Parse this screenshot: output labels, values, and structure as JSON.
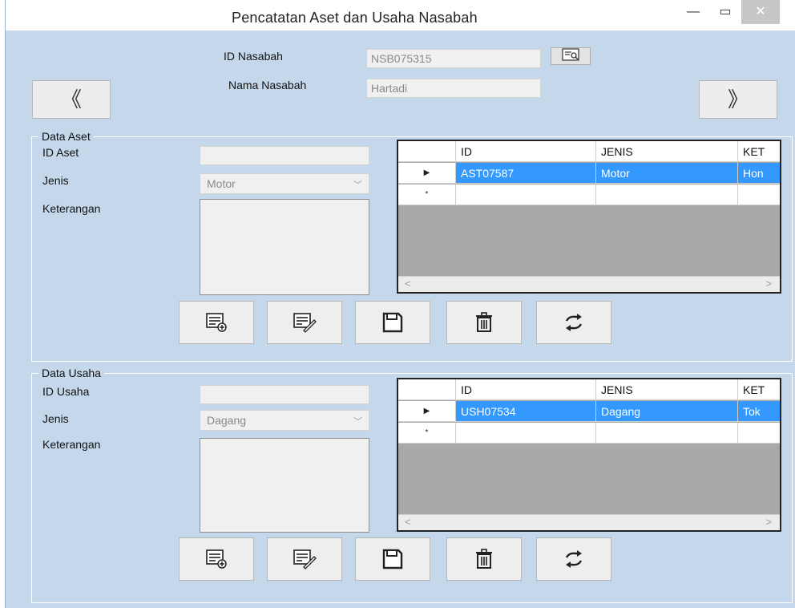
{
  "window": {
    "title": "Pencatatan Aset dan Usaha Nasabah",
    "min_glyph": "—",
    "max_glyph": "▭",
    "close_glyph": "✕"
  },
  "nasabah": {
    "id_label": "ID Nasabah",
    "id_value": "NSB075315",
    "nama_label": "Nama Nasabah",
    "nama_value": "Hartadi",
    "prev_glyph": "《",
    "next_glyph": "》"
  },
  "aset": {
    "group_label": "Data Aset",
    "id_label": "ID Aset",
    "id_value": "",
    "jenis_label": "Jenis",
    "jenis_value": "Motor",
    "keterangan_label": "Keterangan",
    "grid": {
      "columns": [
        "ID",
        "JENIS",
        "KET"
      ],
      "rows": [
        [
          "AST07587",
          "Motor",
          "Hon"
        ]
      ]
    }
  },
  "usaha": {
    "group_label": "Data Usaha",
    "id_label": "ID Usaha",
    "id_value": "",
    "jenis_label": "Jenis",
    "jenis_value": "Dagang",
    "keterangan_label": "Keterangan",
    "grid": {
      "columns": [
        "ID",
        "JENIS",
        "KET"
      ],
      "rows": [
        [
          "USH07534",
          "Dagang",
          "Tok"
        ]
      ]
    }
  },
  "glyphs": {
    "row_pointer": "▶",
    "new_row": "*",
    "scroll_left": "<",
    "scroll_right": ">",
    "combo_arrow": "﹀"
  },
  "icons": [
    "add-record-icon",
    "edit-record-icon",
    "save-icon",
    "delete-icon",
    "refresh-icon",
    "lookup-icon"
  ],
  "colors": {
    "background": "#c5d8eb",
    "selection": "#3399ff",
    "grid_empty": "#a9a9a9"
  }
}
